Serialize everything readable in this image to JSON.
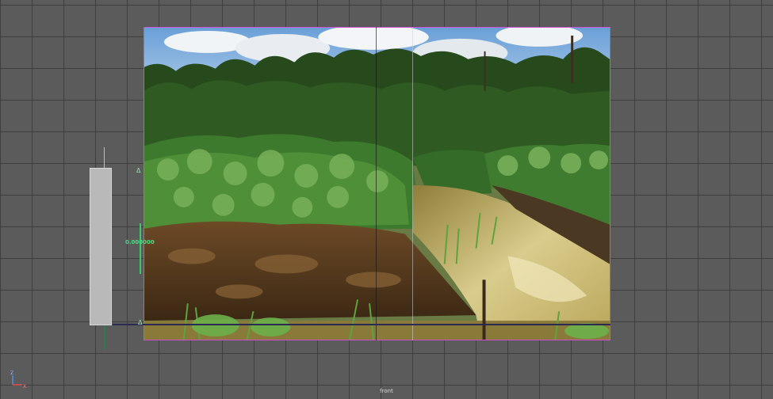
{
  "viewport": {
    "view_name": "front",
    "measurement_label": "0.000000",
    "image_plane": "field-photo",
    "tick_marks": [
      "Δ",
      "Δ"
    ]
  },
  "axis_gizmo": {
    "axes": [
      "Z",
      "X"
    ]
  },
  "colors": {
    "grid_background": "#5b5b5b",
    "grid_lines": "#3f3f3f",
    "image_border": "#d24fd2",
    "measure": "#33cc66",
    "ground_line": "#2a2a52"
  }
}
